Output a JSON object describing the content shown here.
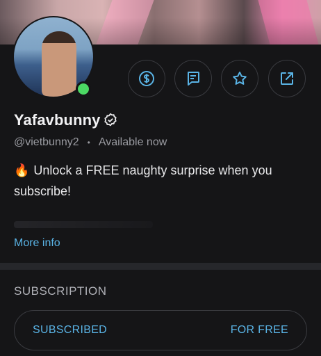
{
  "profile": {
    "name": "Yafavbunny",
    "handle": "@vietbunny2",
    "separator": "•",
    "status": "Available now",
    "bio_emoji": "🔥",
    "bio": "Unlock a FREE naughty surprise when you subscribe!",
    "more_info": "More info",
    "online": true
  },
  "actions": [
    {
      "name": "tip",
      "icon": "dollar-icon"
    },
    {
      "name": "message",
      "icon": "message-icon"
    },
    {
      "name": "favorite",
      "icon": "star-icon"
    },
    {
      "name": "share",
      "icon": "share-icon"
    }
  ],
  "subscription": {
    "title": "SUBSCRIPTION",
    "left_label": "SUBSCRIBED",
    "right_label": "FOR FREE"
  },
  "colors": {
    "background": "#151517",
    "accent": "#5ab4e6",
    "online": "#4cd964"
  }
}
